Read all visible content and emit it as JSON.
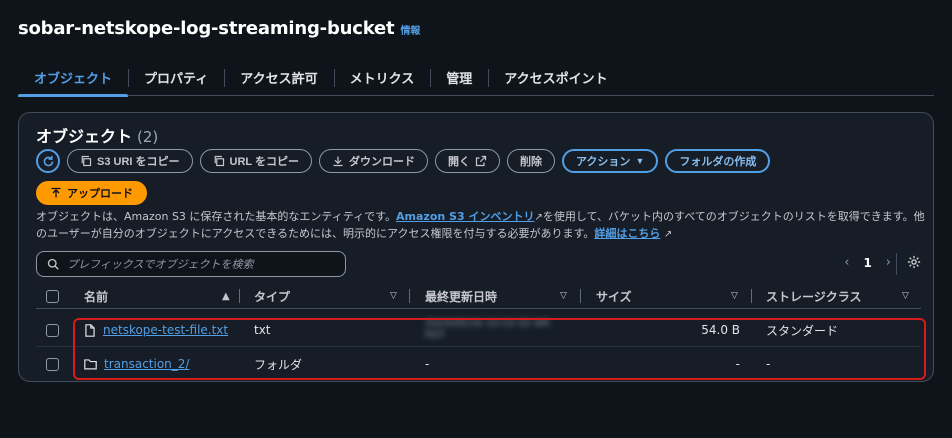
{
  "header": {
    "title": "sobar-netskope-log-streaming-bucket",
    "info": "情報"
  },
  "tabs": [
    {
      "label": "オブジェクト",
      "active": true
    },
    {
      "label": "プロパティ"
    },
    {
      "label": "アクセス許可"
    },
    {
      "label": "メトリクス"
    },
    {
      "label": "管理"
    },
    {
      "label": "アクセスポイント"
    }
  ],
  "objects": {
    "title": "オブジェクト",
    "count": "(2)",
    "toolbar": {
      "copy_s3_uri": "S3 URI をコピー",
      "copy_url": "URL をコピー",
      "download": "ダウンロード",
      "open": "開く",
      "delete": "削除",
      "actions": "アクション",
      "create_folder": "フォルダの作成",
      "upload": "アップロード"
    },
    "description": {
      "part1": "オブジェクトは、Amazon S3 に保存された基本的なエンティティです。",
      "inventory_link": "Amazon S3 インベントリ",
      "part2": "を使用して、バケット内のすべてのオブジェクトのリストを取得できます。他のユーザーが自分のオブジェクトにアクセスできるためには、明示的にアクセス権限を付与する必要があります。",
      "details_link": "詳細はこちら"
    },
    "search": {
      "placeholder": "プレフィックスでオブジェクトを検索"
    },
    "pagination": {
      "page": "1"
    },
    "columns": {
      "name": "名前",
      "type": "タイプ",
      "last_modified": "最終更新日時",
      "size": "サイズ",
      "storage_class": "ストレージクラス"
    },
    "rows": [
      {
        "name": "netskope-test-file.txt",
        "type": "txt",
        "last_modified": "2024/05/16 10:15:32 AM PDT",
        "size": "54.0 B",
        "storage_class": "スタンダード"
      },
      {
        "name": "transaction_2/",
        "type": "フォルダ",
        "last_modified": "-",
        "size": "-",
        "storage_class": "-"
      }
    ]
  },
  "colors": {
    "accent": "#539fe5",
    "primary_button": "#ff9900",
    "highlight": "#d61b1b",
    "background": "#0f141a"
  }
}
